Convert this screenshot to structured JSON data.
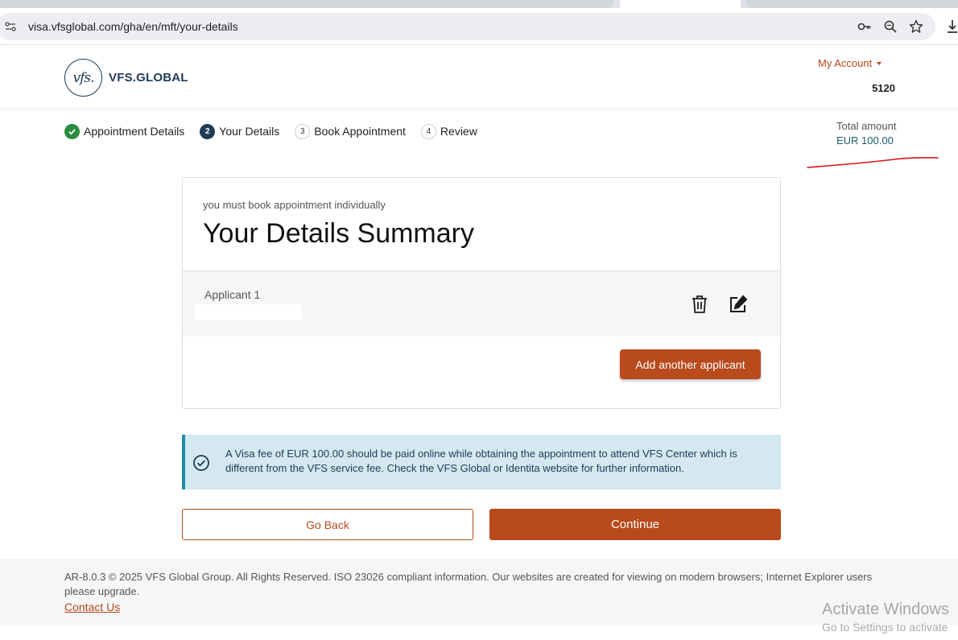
{
  "browser": {
    "url": "visa.vfsglobal.com/gha/en/mft/your-details"
  },
  "header": {
    "logo_mark": "vfs.",
    "logo_text": "VFS.GLOBAL",
    "my_account_label": "My Account",
    "account_number_partial": "5120"
  },
  "stepper": {
    "steps": [
      {
        "number": "",
        "label": "Appointment Details",
        "state": "done"
      },
      {
        "number": "2",
        "label": "Your Details",
        "state": "active"
      },
      {
        "number": "3",
        "label": "Book Appointment",
        "state": "pending"
      },
      {
        "number": "4",
        "label": "Review",
        "state": "pending"
      }
    ],
    "total_label": "Total amount",
    "total_value": "EUR 100.00"
  },
  "card": {
    "note": "you must book appointment individually",
    "title": "Your Details Summary",
    "applicant_label": "Applicant 1",
    "add_button": "Add another applicant"
  },
  "info": {
    "text": "A Visa fee of EUR 100.00 should be paid online while obtaining the appointment to attend VFS Center which is different from the VFS service fee. Check the VFS Global or Identita website for further information."
  },
  "actions": {
    "back_label": "Go Back",
    "continue_label": "Continue"
  },
  "footer": {
    "text": "AR-8.0.3 © 2025 VFS Global Group. All Rights Reserved. ISO 23026 compliant information. Our websites are created for viewing on modern browsers; Internet Explorer users please upgrade.",
    "contact_label": "Contact Us"
  },
  "watermark": {
    "title": "Activate Windows",
    "subtitle": "Go to Settings to activate"
  },
  "colors": {
    "brand_orange": "#b84a1c",
    "brand_navy": "#1f3b57",
    "success_green": "#2a8a3e",
    "info_bg": "#d3e9ef",
    "annotation_red": "#d0161c"
  }
}
